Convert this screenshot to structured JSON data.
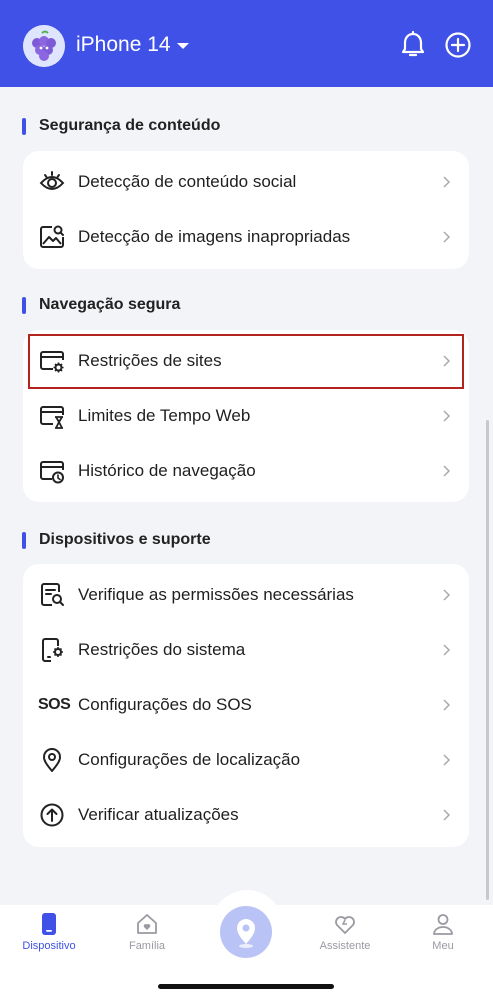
{
  "header": {
    "device_name": "iPhone 14"
  },
  "sections": [
    {
      "title": "Segurança de conteúdo",
      "items": [
        {
          "label": "Detecção de conteúdo social",
          "icon": "eye-icon"
        },
        {
          "label": "Detecção de imagens inapropriadas",
          "icon": "image-scan-icon"
        }
      ]
    },
    {
      "title": "Navegação segura",
      "items": [
        {
          "label": "Restrições de sites",
          "icon": "browser-gear-icon"
        },
        {
          "label": "Limites de Tempo Web",
          "icon": "browser-hourglass-icon"
        },
        {
          "label": "Histórico de navegação",
          "icon": "browser-clock-icon"
        }
      ]
    },
    {
      "title": "Dispositivos e suporte",
      "items": [
        {
          "label": "Verifique as permissões necessárias",
          "icon": "permissions-search-icon"
        },
        {
          "label": "Restrições do sistema",
          "icon": "phone-gear-icon"
        },
        {
          "label": "Configurações do SOS",
          "icon": "sos-icon",
          "icon_text": "SOS"
        },
        {
          "label": "Configurações de localização",
          "icon": "location-pin-icon"
        },
        {
          "label": "Verificar atualizações",
          "icon": "upload-circle-icon"
        }
      ]
    }
  ],
  "tabs": [
    {
      "label": "Dispositivo",
      "icon": "phone-icon",
      "active": true
    },
    {
      "label": "Família",
      "icon": "house-heart-icon",
      "active": false
    },
    {
      "label": "Assistente",
      "icon": "heart-icon",
      "active": false
    },
    {
      "label": "Meu",
      "icon": "person-icon",
      "active": false
    }
  ],
  "colors": {
    "accent": "#3f51e6",
    "highlight_border": "#b3241e",
    "background": "#f3f4f8"
  }
}
